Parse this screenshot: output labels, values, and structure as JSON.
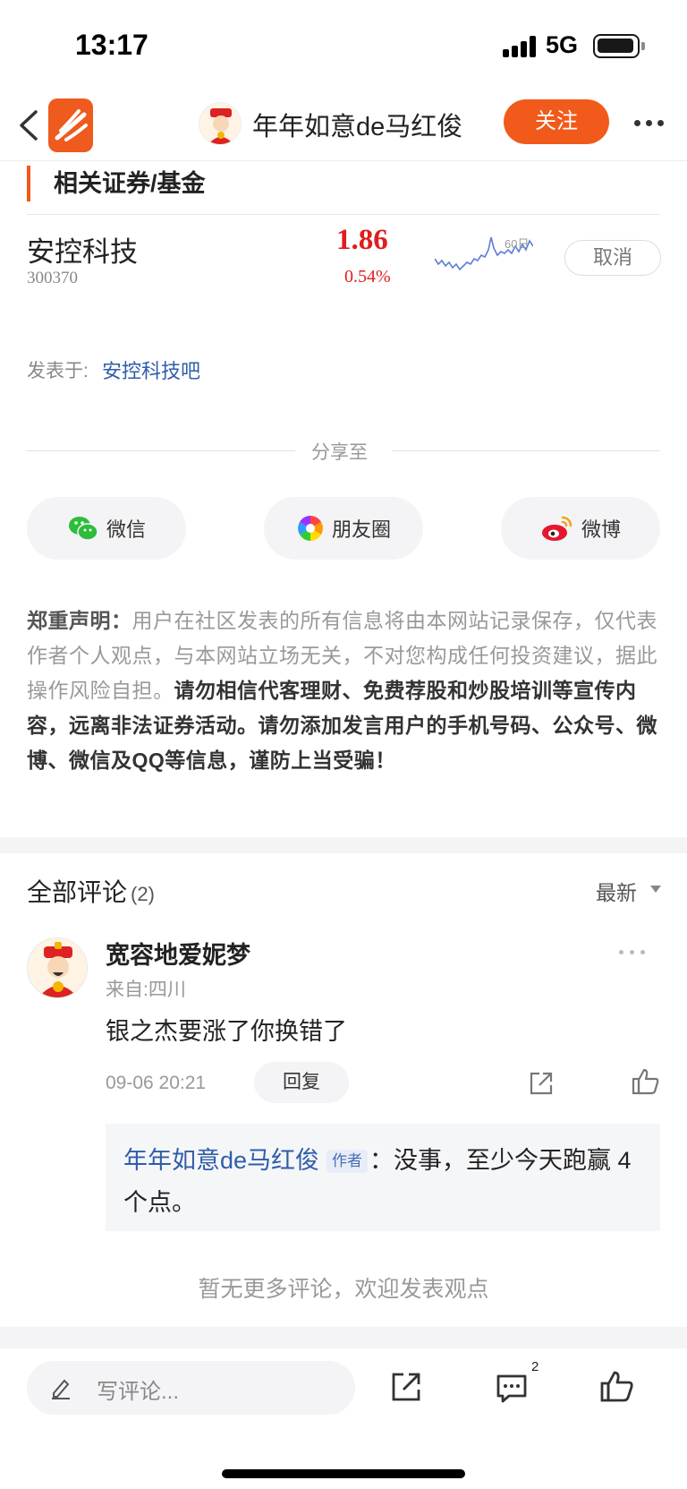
{
  "status_bar": {
    "time": "13:17",
    "network": "5G"
  },
  "nav": {
    "title": "年年如意de马红俊",
    "follow_label": "关注"
  },
  "related": {
    "heading": "相关证券/基金",
    "stock": {
      "name": "安控科技",
      "code": "300370",
      "price": "1.86",
      "change_pct": "0.54%",
      "spark_label": "60日",
      "cancel_label": "取消"
    }
  },
  "posted": {
    "label": "发表于:",
    "forum": "安控科技吧"
  },
  "share": {
    "title": "分享至",
    "buttons": [
      {
        "label": "微信",
        "icon": "wechat-icon"
      },
      {
        "label": "朋友圈",
        "icon": "moments-icon"
      },
      {
        "label": "微博",
        "icon": "weibo-icon"
      }
    ]
  },
  "disclaimer": {
    "lead": "郑重声明：",
    "body": "用户在社区发表的所有信息将由本网站记录保存，仅代表作者个人观点，与本网站立场无关，不对您构成任何投资建议，据此操作风险自担。",
    "warning": "请勿相信代客理财、免费荐股和炒股培训等宣传内容，远离非法证券活动。请勿添加发言用户的手机号码、公众号、微博、微信及QQ等信息，谨防上当受骗！"
  },
  "comments": {
    "title": "全部评论",
    "count": "(2)",
    "sort_label": "最新",
    "items": [
      {
        "user": "宽容地爱妮梦",
        "from": "来自:四川",
        "text": "银之杰要涨了你换错了",
        "time": "09-06 20:21",
        "reply_label": "回复",
        "reply": {
          "author": "年年如意de马红俊",
          "tag": "作者",
          "sep": "：",
          "text": "没事，至少今天跑赢 4 个点。"
        }
      }
    ],
    "no_more": "暂无更多评论，欢迎发表观点"
  },
  "bottom_bar": {
    "placeholder": "写评论...",
    "comment_badge": "2"
  },
  "colors": {
    "accent": "#f15a1a",
    "price_up": "#e11d1d",
    "link": "#2f5da8"
  }
}
